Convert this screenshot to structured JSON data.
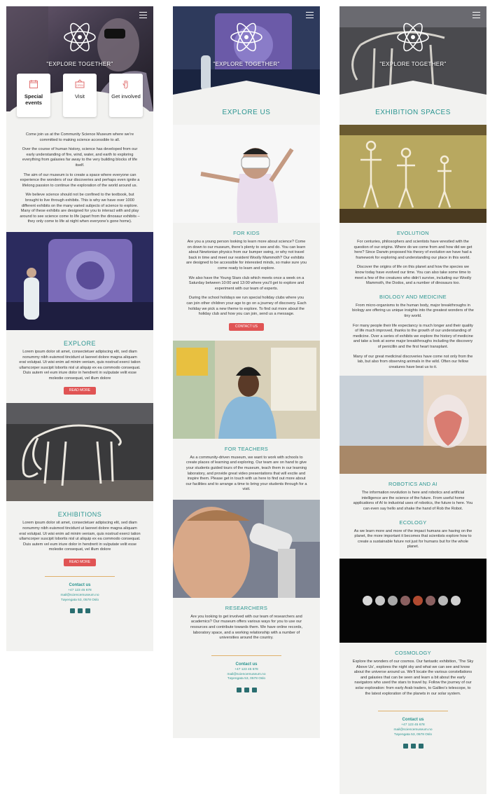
{
  "common": {
    "tagline": "\"EXPLORE TOGETHER\"",
    "contact_title": "Contact us",
    "phone": "+47 123 45 678",
    "email": "mail@sciencemuseum.no",
    "address": "Tøyengata 53, 0578 Oslo",
    "more_button": "READ MORE",
    "contact_button": "CONTACT US",
    "accent_color": "#2a9590",
    "button_color": "#e05454"
  },
  "screen1": {
    "cards": [
      {
        "label": "Special events",
        "icon": "calendar-icon"
      },
      {
        "label": "Visit",
        "icon": "open-sign-icon"
      },
      {
        "label": "Get involved",
        "icon": "raised-hand-icon"
      }
    ],
    "intro": [
      "Come join us at the Community Science Museum where we’re committed to making science accessible to all.",
      "Over the course of human history, science has developed from our early understanding of fire, wind, water, and earth to exploring everything from galaxies far away to the very building blocks of life itself.",
      "The aim of our museum is to create a space where everyone can experience the wonders of our discoveries and perhaps even ignite a lifelong passion to continue the exploration of the world around us.",
      "We believe science should not be confined to the textbook, but brought to live through exhibits. This is why we have over 1000 different exhibits on the many varied subjects of science to explore. Many of these exhibits are designed for you to interact with and play around to see science come to life (apart from the dinosaur exhibits – they only come to life at night when everyone’s gone home)."
    ],
    "explore_title": "EXPLORE",
    "explore_text": "Lorem ipsum dolor sit amet, consectetuer adipiscing elit, sed diam nonummy nibh euismod tincidunt ut laoreet dolore magna aliquam erat volutpat. Ut wisi enim ad minim veniam, quis nostrud exerci tation ullamcorper suscipit lobortis nisl ut aliquip ex ea commodo consequat. Duis autem vel eum iriure dolor in hendrerit in vulputate velit esse molestie consequat, vel illum dolore",
    "exhibitions_title": "EXHIBITIONS",
    "exhibitions_text": "Lorem ipsum dolor sit amet, consectetuer adipiscing elit, sed diam nonummy nibh euismod tincidunt ut laoreet dolore magna aliquam erat volutpat. Ut wisi enim ad minim veniam, quis nostrud exerci tation ullamcorper suscipit lobortis nisl ut aliquip ex ea commodo consequat. Duis autem vel eum iriure dolor in hendrerit in vulputate velit esse molestie consequat, vel illum dolore"
  },
  "screen2": {
    "heading": "EXPLORE US",
    "kids_title": "FOR KIDS",
    "kids_text": [
      "Are you a young person looking to learn more about science? Come on down to our museum, there’s plenty to see and do. You can learn about Newtonian physics from our bumper swing, or why not travel back in time and meet our resident Woolly Mammoth? Our exhibits are designed to be accessible for interested minds, so make sure you come ready to learn and explore.",
      "We also have the Young Stars club which meets once a week on a Saturday between 10:00 and 13:00 where you’ll get to explore and experiment with our team of experts.",
      "During the school holidays we run special holiday clubs where you can join other children your age to go on a journey of discovery. Each holiday we pick a new theme to explore. To find out more about the holiday club and how you can join, send us a message."
    ],
    "teachers_title": "FOR TEACHERS",
    "teachers_text": "As a community-driven museum, we want to work with schools to create places of learning and exploring. Our team are on hand to give your students guided tours of the museum, teach them in our learning laboratory, and provide great video presentations that will excite and inspire them. Please get in touch with us here to find out more about our facilities and to arrange a time to bring your students through for a visit.",
    "researchers_title": "RESEARCHERS",
    "researchers_text": "Are you looking to get involved with our team of researchers and academics? Our museum offers various ways for you to use our resources and contribute towards them. We have online records, laboratory space, and a working relationship with a number of universities around the country."
  },
  "screen3": {
    "heading": "EXHIBITION SPACES",
    "evolution_title": "EVOLUTION",
    "evolution_text": [
      "For centuries, philosophers and scientists have wrestled with the question of our origins. Where do we come from and how did we get here? Since Darwin proposed his theory of evolution we have had a framework for exploring and understanding our place in this world.",
      "Discover the origins of life on this planet and how the species we know today have evolved our time. You can also take some time to meet a few of the creatures who didn’t survive, including our Woolly Mammoth, the Dodos, and a number of dinosaurs too."
    ],
    "biology_title": "BIOLOGY AND MEDICINE",
    "biology_text": [
      "From micro-organisms to the human body, major breakthroughs in biology are offering us unique insights into the greatest wonders of the tiny world.",
      "For many people their life expectancy is much longer and their quality of life much improved, thanks to the growth of our understanding of medicine. Over a series of exhibits we explore the history of medicine and take a look at some major breakthroughs including the discovery of penicillin and the first heart transplant.",
      "Many of our great medicinal discoveries have come not only from the lab, but also from observing animals in the wild. Often our fellow creatures have beat us to it."
    ],
    "robotics_title": "ROBOTICS AND AI",
    "robotics_text": "The information revolution is here and robotics and artificial intelligence are the science of the future. From useful home applications of AI to industrial uses of robotics, the future is here. You can even say hello and shake the hand of Rob the Robot.",
    "ecology_title": "ECOLOGY",
    "ecology_text": "As we learn more and more of the impact humans are having on the planet, the more important it becomes that scientists explore how to create a sustainable future not just for humans but for the whole planet.",
    "cosmology_title": "COSMOLOGY",
    "cosmology_text": "Explore the wonders of our cosmos. Our fantastic exhibition, ‘The Sky Above Us’, explores the night sky and what we can see and know about the universe around us. We’ll locate the various constellations and galaxies that can be seen and learn a bit about the early navigators who used the stars to travel by. Follow the journey of our solar exploration: from early Arab traders, to Galileo’s telescope, to the latest exploration of the planets in our solar system."
  }
}
